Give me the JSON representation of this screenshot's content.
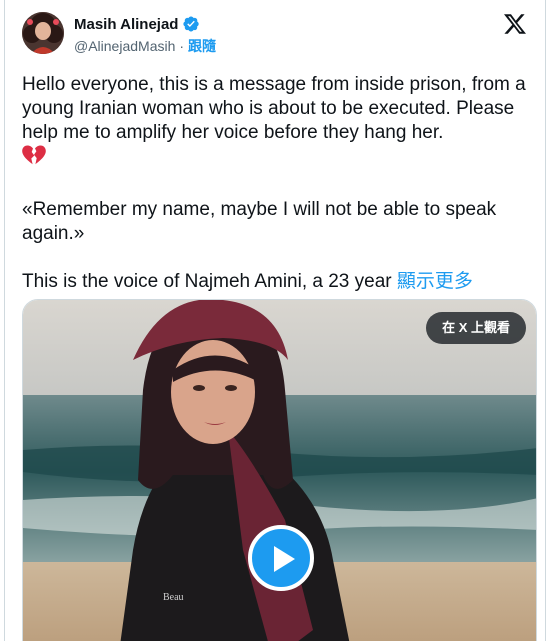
{
  "author": {
    "display_name": "Masih Alinejad",
    "handle": "@AlinejadMasih",
    "separator": "·",
    "follow_label": "跟隨",
    "verified": true
  },
  "tweet": {
    "para1": "Hello everyone, this is a message from inside prison, from a young Iranian woman who is about to be executed. Please help me to amplify her voice before they hang her.",
    "para1_emoji": "broken-heart-icon",
    "para2": "«Remember my name, maybe I will not be able to speak again.»",
    "para3": "This is the voice of Najmeh Amini, a 23 year ",
    "show_more": "顯示更多"
  },
  "media": {
    "watch_on_x_label": "在 X 上觀看",
    "play_icon": "play-icon",
    "type": "video"
  },
  "colors": {
    "accent": "#1d9bf0",
    "text": "#0f1419",
    "secondary": "#536471",
    "border": "#cfd9de"
  }
}
